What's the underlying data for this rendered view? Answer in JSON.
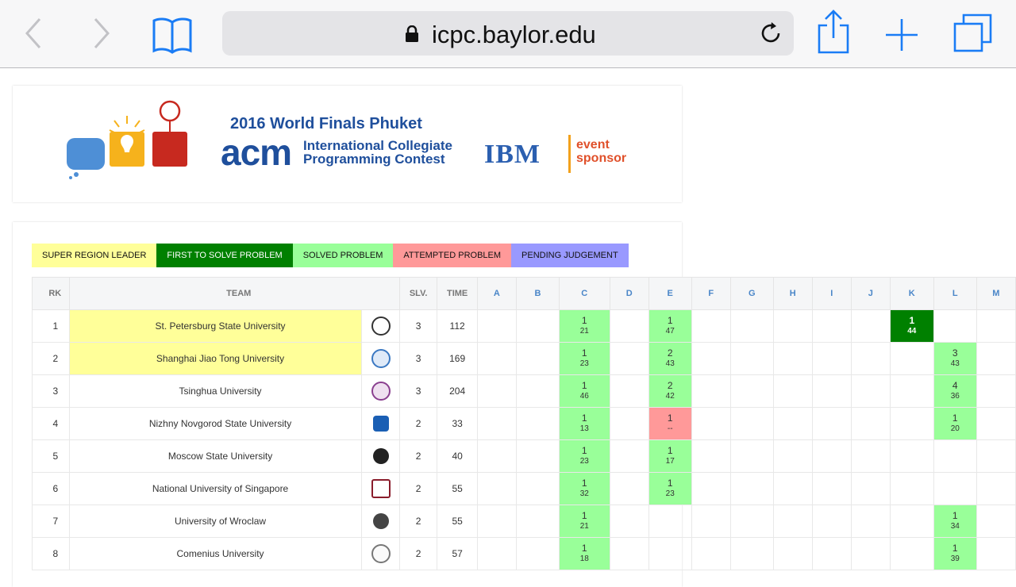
{
  "browser": {
    "url": "icpc.baylor.edu"
  },
  "banner": {
    "title": "2016 World Finals Phuket",
    "acm": "acm",
    "contest_line1": "International Collegiate",
    "contest_line2": "Programming Contest",
    "ibm": "IBM",
    "sponsor_line1": "event",
    "sponsor_line2": "sponsor"
  },
  "legend": {
    "leader": "SUPER REGION LEADER",
    "first": "FIRST TO SOLVE PROBLEM",
    "solved": "SOLVED PROBLEM",
    "attempted": "ATTEMPTED PROBLEM",
    "pending": "PENDING JUDGEMENT"
  },
  "colors": {
    "leader": "#ffff99",
    "first": "#008000",
    "solved": "#99ff99",
    "attempted": "#ff9999",
    "pending": "#9999ff"
  },
  "table": {
    "headers": {
      "rank": "RK",
      "team": "TEAM",
      "solved": "SLV.",
      "time": "TIME"
    },
    "problems": [
      "A",
      "B",
      "C",
      "D",
      "E",
      "F",
      "G",
      "H",
      "I",
      "J",
      "K",
      "L",
      "M"
    ],
    "rows": [
      {
        "rank": "1",
        "team": "St. Petersburg State University",
        "slv": "3",
        "time": "112",
        "leader": true,
        "cells": {
          "C": {
            "s": "solved",
            "t": "1",
            "m": "21"
          },
          "E": {
            "s": "solved",
            "t": "1",
            "m": "47"
          },
          "K": {
            "s": "first",
            "t": "1",
            "m": "44"
          }
        }
      },
      {
        "rank": "2",
        "team": "Shanghai Jiao Tong University",
        "slv": "3",
        "time": "169",
        "leader": true,
        "cells": {
          "C": {
            "s": "solved",
            "t": "1",
            "m": "23"
          },
          "E": {
            "s": "solved",
            "t": "2",
            "m": "43"
          },
          "L": {
            "s": "solved",
            "t": "3",
            "m": "43"
          }
        }
      },
      {
        "rank": "3",
        "team": "Tsinghua University",
        "slv": "3",
        "time": "204",
        "leader": false,
        "cells": {
          "C": {
            "s": "solved",
            "t": "1",
            "m": "46"
          },
          "E": {
            "s": "solved",
            "t": "2",
            "m": "42"
          },
          "L": {
            "s": "solved",
            "t": "4",
            "m": "36"
          }
        }
      },
      {
        "rank": "4",
        "team": "Nizhny Novgorod State University",
        "slv": "2",
        "time": "33",
        "leader": false,
        "cells": {
          "C": {
            "s": "solved",
            "t": "1",
            "m": "13"
          },
          "E": {
            "s": "attempt",
            "t": "1",
            "m": "--"
          },
          "L": {
            "s": "solved",
            "t": "1",
            "m": "20"
          }
        }
      },
      {
        "rank": "5",
        "team": "Moscow State University",
        "slv": "2",
        "time": "40",
        "leader": false,
        "cells": {
          "C": {
            "s": "solved",
            "t": "1",
            "m": "23"
          },
          "E": {
            "s": "solved",
            "t": "1",
            "m": "17"
          }
        }
      },
      {
        "rank": "6",
        "team": "National University of Singapore",
        "slv": "2",
        "time": "55",
        "leader": false,
        "cells": {
          "C": {
            "s": "solved",
            "t": "1",
            "m": "32"
          },
          "E": {
            "s": "solved",
            "t": "1",
            "m": "23"
          }
        }
      },
      {
        "rank": "7",
        "team": "University of Wroclaw",
        "slv": "2",
        "time": "55",
        "leader": false,
        "cells": {
          "C": {
            "s": "solved",
            "t": "1",
            "m": "21"
          },
          "L": {
            "s": "solved",
            "t": "1",
            "m": "34"
          }
        }
      },
      {
        "rank": "8",
        "team": "Comenius University",
        "slv": "2",
        "time": "57",
        "leader": false,
        "cells": {
          "C": {
            "s": "solved",
            "t": "1",
            "m": "18"
          },
          "L": {
            "s": "solved",
            "t": "1",
            "m": "39"
          }
        }
      }
    ]
  }
}
